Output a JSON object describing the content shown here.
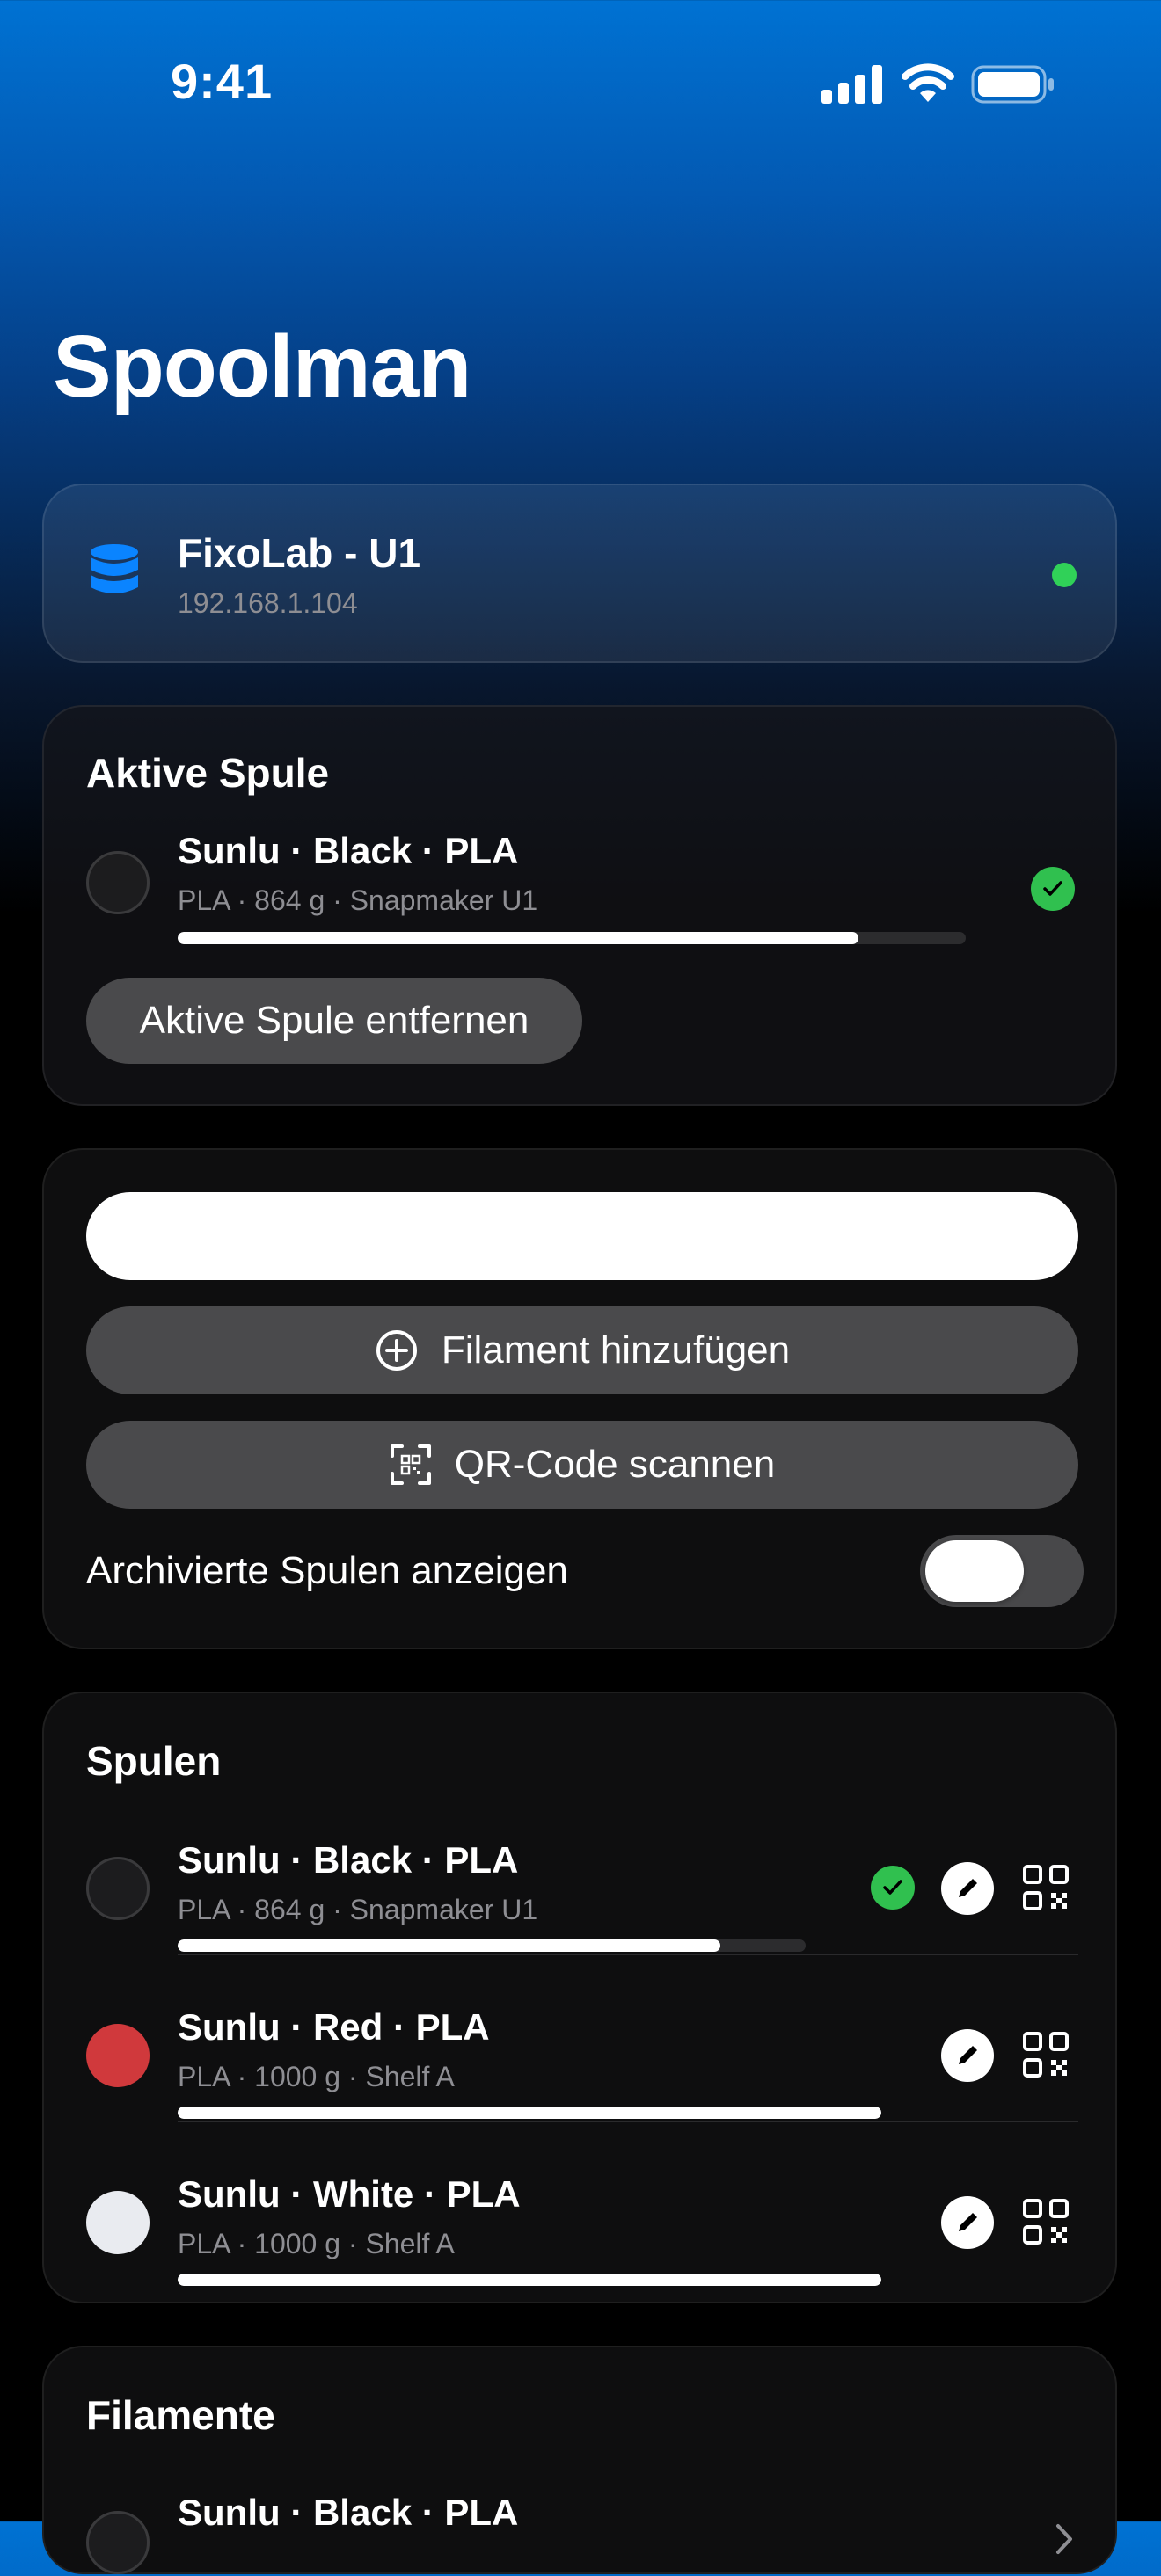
{
  "status_bar": {
    "time": "9:41"
  },
  "page": {
    "title": "Spoolman"
  },
  "server": {
    "name": "FixoLab - U1",
    "address": "192.168.1.104",
    "online_color": "#30d158"
  },
  "active_spool": {
    "heading": "Aktive Spule",
    "name": "Sunlu · Black · PLA",
    "details": "PLA · 864 g · Snapmaker U1",
    "remaining_fraction": 0.864,
    "color": "#1c1c1e",
    "remove_label": "Aktive Spule entfernen"
  },
  "actions": {
    "search_value": "",
    "add_filament_label": "Filament hinzufügen",
    "scan_qr_label": "QR-Code scannen",
    "show_archived_label": "Archivierte Spulen anzeigen",
    "show_archived_on": false
  },
  "spools": {
    "heading": "Spulen",
    "items": [
      {
        "name": "Sunlu · Black · PLA",
        "details": "PLA · 864 g · Snapmaker U1",
        "remaining_fraction": 0.864,
        "color": "#1c1c1e",
        "active": true
      },
      {
        "name": "Sunlu · Red · PLA",
        "details": "PLA · 1000 g · Shelf A",
        "remaining_fraction": 1.0,
        "color": "#d0393c",
        "active": false
      },
      {
        "name": "Sunlu · White · PLA",
        "details": "PLA · 1000 g · Shelf A",
        "remaining_fraction": 1.0,
        "color": "#e9ebf0",
        "active": false
      }
    ]
  },
  "filaments": {
    "heading": "Filamente",
    "items": [
      {
        "name": "Sunlu · Black · PLA",
        "color": "#1c1c1e"
      }
    ]
  },
  "icons": {
    "server": "database-icon",
    "add": "plus-circle-icon",
    "scan": "qr-scan-icon",
    "edit": "pencil-icon",
    "qr": "qr-code-icon",
    "active": "checkmark-circle-icon",
    "chevron": "chevron-right-icon"
  }
}
